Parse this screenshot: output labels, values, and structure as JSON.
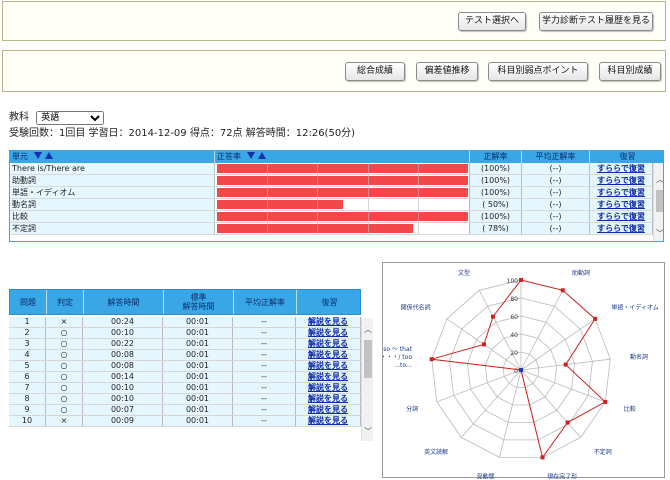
{
  "top_buttons": {
    "test_select": "テスト選択へ",
    "history": "学力診断テスト履歴を見る"
  },
  "tab_buttons": [
    "総合成績",
    "偏差値推移",
    "科目別弱点ポイント",
    "科目別成績"
  ],
  "subject": {
    "label": "教科",
    "selected": "英語"
  },
  "summary": "受験回数：1回目 学習日：2014-12-09 得点：72点 解答時間：12:26(50分)",
  "unit_table": {
    "headers": [
      "単元",
      "正答率",
      "正解率",
      "平均正解率",
      "復習"
    ],
    "rows": [
      {
        "name": "There is/There are",
        "rate": 100,
        "rate_text": "(100%)",
        "avg": "(--)",
        "link": "すららで復習"
      },
      {
        "name": "助動詞",
        "rate": 100,
        "rate_text": "(100%)",
        "avg": "(--)",
        "link": "すららで復習"
      },
      {
        "name": "単語・イディオム",
        "rate": 100,
        "rate_text": "(100%)",
        "avg": "(--)",
        "link": "すららで復習"
      },
      {
        "name": "動名詞",
        "rate": 50,
        "rate_text": "( 50%)",
        "avg": "(--)",
        "link": "すららで復習"
      },
      {
        "name": "比較",
        "rate": 100,
        "rate_text": "(100%)",
        "avg": "(--)",
        "link": "すららで復習"
      },
      {
        "name": "不定詞",
        "rate": 78,
        "rate_text": "( 78%)",
        "avg": "(--)",
        "link": "すららで復習"
      }
    ],
    "bar_color": "#f3484a"
  },
  "question_table": {
    "headers": [
      "問題",
      "判定",
      "解答時間",
      "標準\n解答時間",
      "平均正解率",
      "復習"
    ],
    "rows": [
      {
        "no": "1",
        "judge": "×",
        "time": "00:24",
        "std": "00:01",
        "avg": "--",
        "link": "解説を見る"
      },
      {
        "no": "2",
        "judge": "○",
        "time": "00:10",
        "std": "00:01",
        "avg": "--",
        "link": "解説を見る"
      },
      {
        "no": "3",
        "judge": "○",
        "time": "00:22",
        "std": "00:01",
        "avg": "--",
        "link": "解説を見る"
      },
      {
        "no": "4",
        "judge": "○",
        "time": "00:08",
        "std": "00:01",
        "avg": "--",
        "link": "解説を見る"
      },
      {
        "no": "5",
        "judge": "○",
        "time": "00:08",
        "std": "00:01",
        "avg": "--",
        "link": "解説を見る"
      },
      {
        "no": "6",
        "judge": "○",
        "time": "00:14",
        "std": "00:01",
        "avg": "--",
        "link": "解説を見る"
      },
      {
        "no": "7",
        "judge": "○",
        "time": "00:10",
        "std": "00:01",
        "avg": "--",
        "link": "解説を見る"
      },
      {
        "no": "8",
        "judge": "○",
        "time": "00:10",
        "std": "00:01",
        "avg": "--",
        "link": "解説を見る"
      },
      {
        "no": "9",
        "judge": "○",
        "time": "00:07",
        "std": "00:01",
        "avg": "--",
        "link": "解説を見る"
      },
      {
        "no": "10",
        "judge": "×",
        "time": "00:09",
        "std": "00:01",
        "avg": "--",
        "link": "解説を見る"
      }
    ]
  },
  "radar": {
    "scale_labels": [
      "0",
      "20",
      "40",
      "60",
      "80",
      "100"
    ],
    "axes": [
      {
        "label": "There is/There are",
        "value": 100
      },
      {
        "label": "助動詞",
        "value": 100
      },
      {
        "label": "単語・イディオム",
        "value": 100
      },
      {
        "label": "動名詞",
        "value": 50
      },
      {
        "label": "比較",
        "value": 100
      },
      {
        "label": "不定詞",
        "value": 78
      },
      {
        "label": "現在完了形",
        "value": 100
      },
      {
        "label": "受動態",
        "value": 0
      },
      {
        "label": "英文読解",
        "value": 0
      },
      {
        "label": "分詞",
        "value": 0
      },
      {
        "label": "so ～ that\n・・・/ too\n…to…",
        "value": 100
      },
      {
        "label": "関係代名詞",
        "value": 50
      },
      {
        "label": "文型",
        "value": 67
      }
    ],
    "line_color": "#cc2222"
  }
}
